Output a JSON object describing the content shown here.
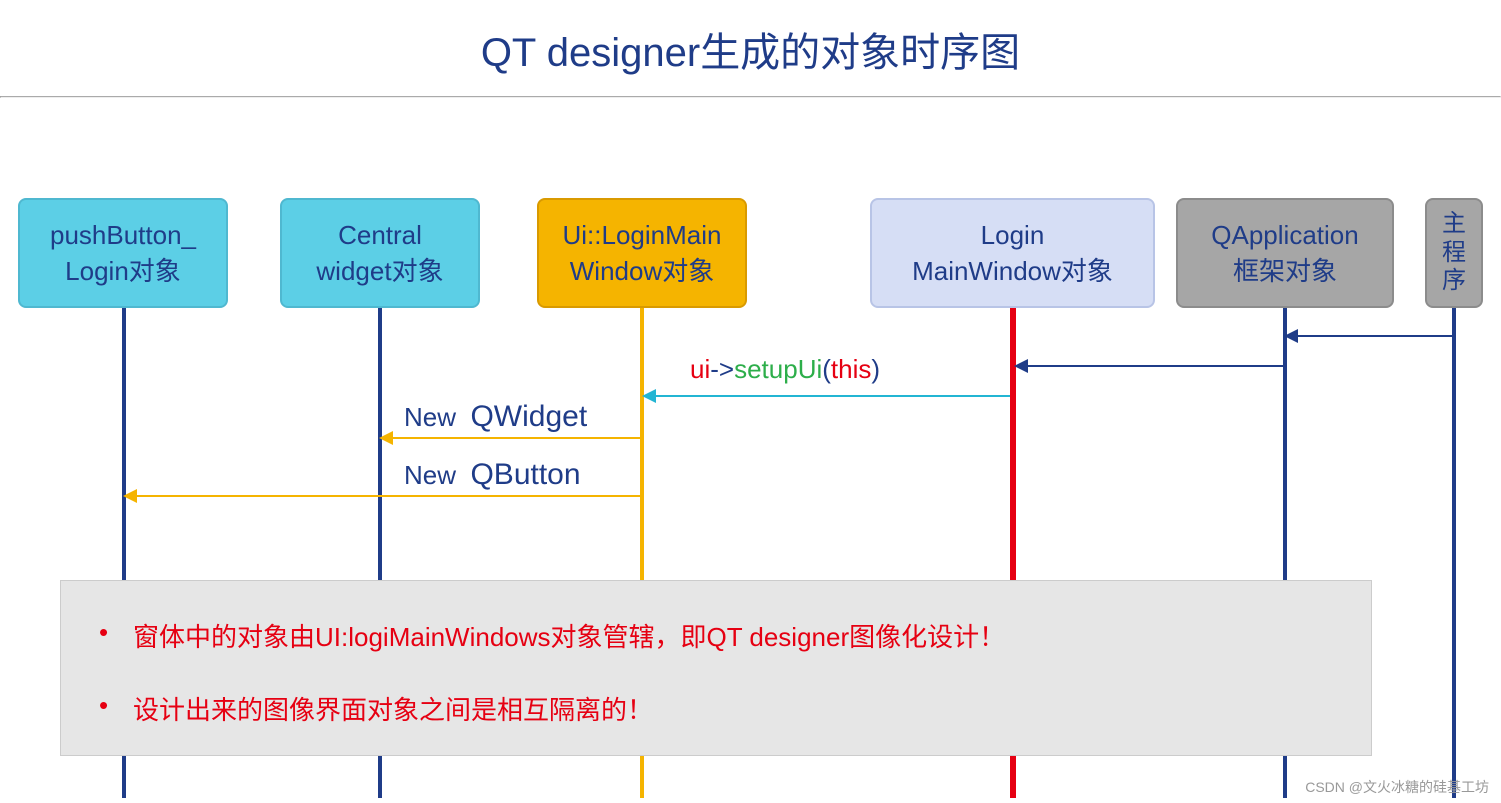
{
  "title": "QT designer生成的对象时序图",
  "boxes": {
    "pushButton": "pushButton_\nLogin对象",
    "central": "Central\nwidget对象",
    "uiLogin": "Ui::LoginMain\nWindow对象",
    "loginMain": "Login\nMainWindow对象",
    "qapp": "QApplication\n框架对象",
    "main": "主\n程\n序"
  },
  "messages": {
    "setupUi": {
      "ui_prefix": "ui",
      "arrow": "->",
      "setup": "setupUi",
      "paren_open": "(",
      "this": "this",
      "paren_close": ")"
    },
    "newQWidget_new": "New",
    "newQWidget_cls": "QWidget",
    "newQButton_new": "New",
    "newQButton_cls": "QButton"
  },
  "notes": [
    "窗体中的对象由UI:logiMainWindows对象管辖，即QT designer图像化设计！",
    "设计出来的图像界面对象之间是相互隔离的！"
  ],
  "watermark": "CSDN @文火冰糖的硅基工坊",
  "colors": {
    "navy": "#1F3C88",
    "red": "#E60012",
    "green": "#2DAE4A",
    "cyan": "#23B5D3",
    "orange": "#F5B400",
    "gray": "#8C8C8C"
  }
}
